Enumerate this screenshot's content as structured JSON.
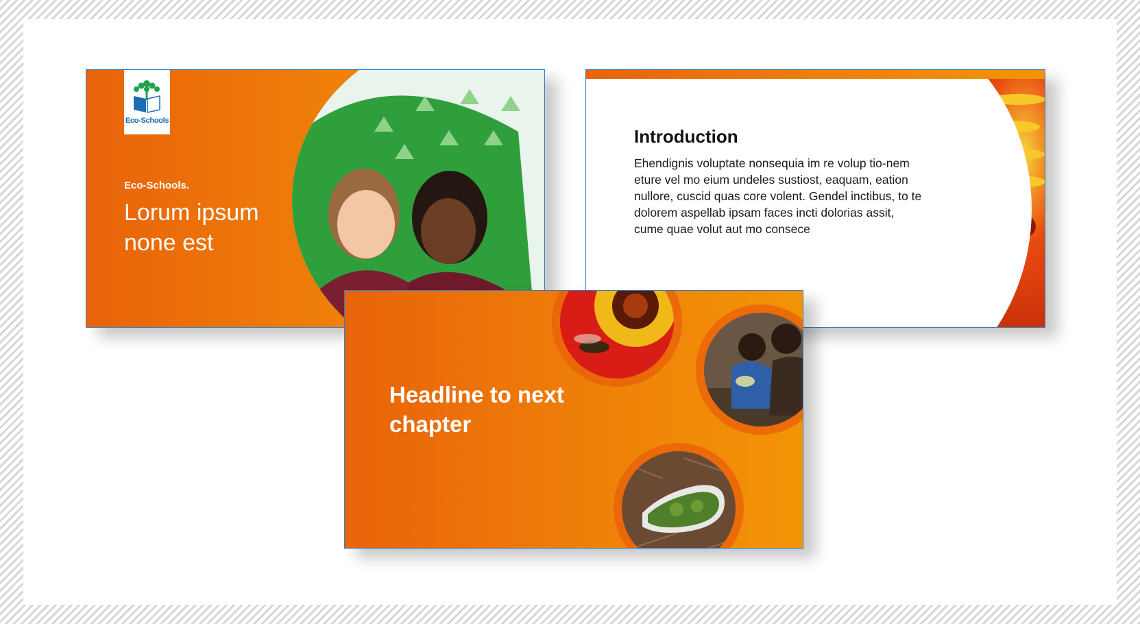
{
  "slides": [
    {
      "logo_text": "Eco-Schools",
      "kicker": "Eco-Schools.",
      "title": "Lorum ipsum none est"
    },
    {
      "title": "Introduction",
      "body": "Ehendignis voluptate nonsequia im re volup tio-nem eture vel mo eium undeles sustiost, eaquam, eation nullore, cuscid quas core volent. Gendel inctibus, to te dolorem aspellab ipsam faces incti dolorias assit, cume quae volut aut mo consece"
    },
    {
      "title": "Headline to next chapter"
    }
  ],
  "colors": {
    "orange_start": "#e9630a",
    "orange_end": "#f29406",
    "eco_green": "#1fa34a",
    "eco_blue": "#1d6db5"
  }
}
